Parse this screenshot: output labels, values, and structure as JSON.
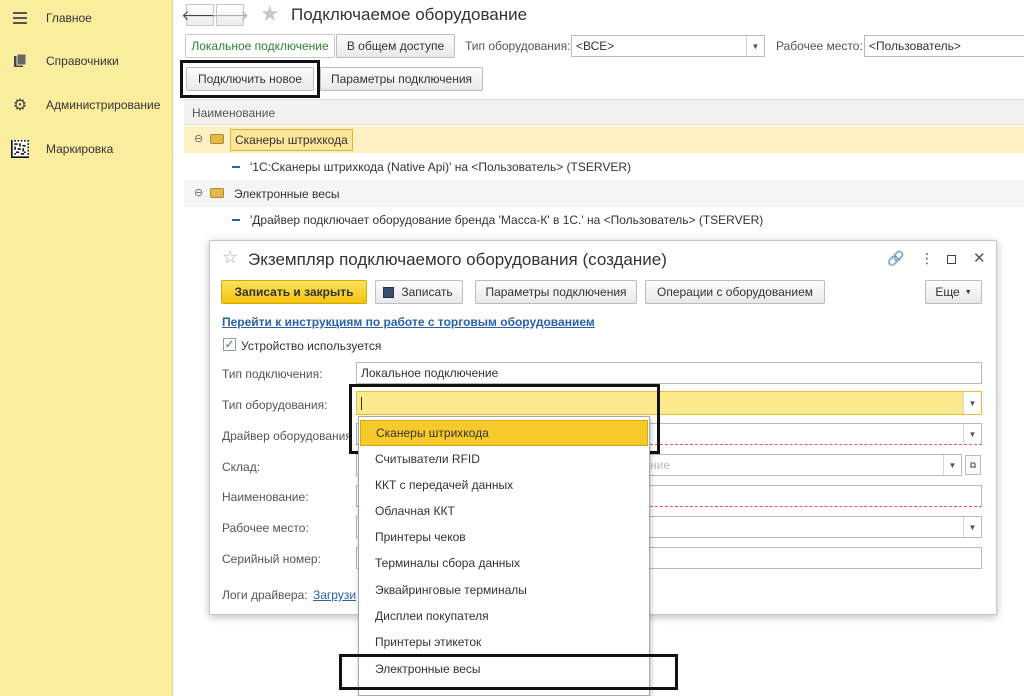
{
  "sidebar": {
    "items": [
      {
        "label": "Главное",
        "icon": "menu-icon"
      },
      {
        "label": "Справочники",
        "icon": "books-icon"
      },
      {
        "label": "Администрирование",
        "icon": "gear-icon"
      },
      {
        "label": "Маркировка",
        "icon": "datamatrix-icon"
      }
    ]
  },
  "header": {
    "title": "Подключаемое оборудование",
    "back": "🡐",
    "forward": "🡒",
    "star": "★"
  },
  "toolbar": {
    "tab_local": "Локальное подключение",
    "tab_shared": "В общем доступе",
    "type_label": "Тип оборудования:",
    "type_value": "<ВСЕ>",
    "workplace_label": "Рабочее место:",
    "workplace_value": "<Пользователь>",
    "connect_new": "Подключить новое",
    "connection_params": "Параметры подключения"
  },
  "list": {
    "column_header": "Наименование",
    "groups": [
      {
        "name": "Сканеры штрихкода",
        "item": "'1С:Сканеры штрихкода (Native Api)' на <Пользователь> (TSERVER)"
      },
      {
        "name": "Электронные весы",
        "item": "'Драйвер подключает оборудование бренда 'Масса-К' в 1С.' на <Пользователь> (TSERVER)"
      }
    ]
  },
  "dialog": {
    "title": "Экземпляр подключаемого оборудования (создание)",
    "save_close": "Записать и закрыть",
    "save": "Записать",
    "connection_params": "Параметры подключения",
    "operations": "Операции с оборудованием",
    "more": "Еще",
    "instructions_link": "Перейти к инструкциям по работе с торговым оборудованием",
    "device_used": "Устройство используется",
    "fields": {
      "connection_type_label": "Тип подключения:",
      "connection_type_value": "Локальное подключение",
      "equipment_type_label": "Тип оборудования:",
      "equipment_type_value": "",
      "driver_label": "Драйвер оборудования",
      "warehouse_label": "Склад:",
      "warehouse_placeholder_tail": "ние",
      "name_label": "Наименование:",
      "workplace_label": "Рабочее место:",
      "serial_label": "Серийный номер:",
      "logs_label": "Логи драйвера:",
      "logs_link": "Загрузи"
    }
  },
  "dropdown": {
    "options": [
      "Сканеры штрихкода",
      "Считыватели RFID",
      "ККТ с передачей данных",
      "Облачная ККТ",
      "Принтеры чеков",
      "Терминалы сбора данных",
      "Эквайринговые терминалы",
      "Дисплеи покупателя",
      "Принтеры этикеток",
      "Электронные весы"
    ],
    "selected_index": 0
  },
  "colors": {
    "sidebar_bg": "#fbed9e",
    "accent_yellow": "#fad12e",
    "link_blue": "#2a62a9",
    "tab_green": "#2e7d32"
  }
}
